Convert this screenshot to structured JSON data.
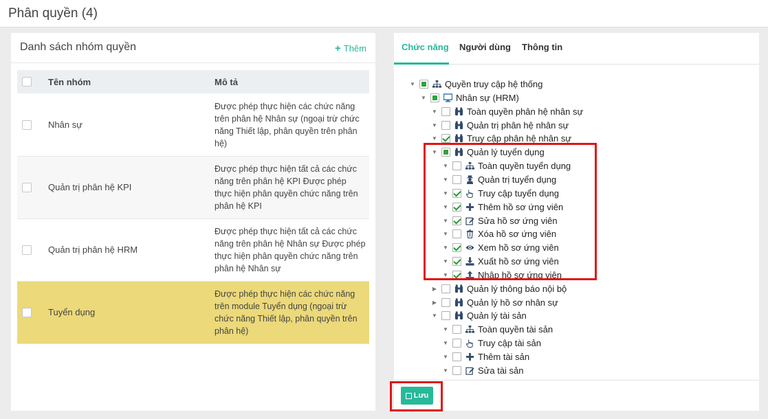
{
  "header": {
    "title": "Phân quyền (4)"
  },
  "left": {
    "title": "Danh sách nhóm quyền",
    "add_label": "Thêm",
    "columns": {
      "name": "Tên nhóm",
      "desc": "Mô tả"
    },
    "rows": [
      {
        "name": "Nhân sự",
        "desc": "Được phép thực hiện các chức năng trên phân hệ Nhân sự (ngoại trừ chức năng Thiết lập, phân quyền trên phân hệ)"
      },
      {
        "name": "Quản trị phân hệ KPI",
        "desc": "Được phép thực hiện tất cả các chức năng trên phân hệ KPI Được phép thực hiện phân quyền chức năng trên phân hệ KPI"
      },
      {
        "name": "Quản trị phân hệ HRM",
        "desc": "Được phép thực hiện tất cả các chức năng trên phân hệ Nhân sự Được phép thực hiện phân quyền chức năng trên phân hệ Nhân sự"
      },
      {
        "name": "Tuyển dụng",
        "desc": "Được phép thực hiện các chức năng trên module Tuyển dụng (ngoại trừ chức năng Thiết lập, phân quyền trên phân hệ)"
      }
    ]
  },
  "right": {
    "tabs": [
      "Chức năng",
      "Người dùng",
      "Thông tin"
    ],
    "tree": [
      {
        "label": "Quyền truy cập hệ thống",
        "level": 0,
        "toggle": "down",
        "check": "partial",
        "icon": "sitemap-icon"
      },
      {
        "label": "Nhân sự (HRM)",
        "level": 1,
        "toggle": "down",
        "check": "partial",
        "icon": "desktop-icon"
      },
      {
        "label": "Toàn quyền phân hệ nhân sự",
        "level": 2,
        "toggle": "down",
        "check": "none",
        "icon": "binoculars-icon"
      },
      {
        "label": "Quản trị phân hệ nhân sự",
        "level": 2,
        "toggle": "down",
        "check": "none",
        "icon": "binoculars-icon"
      },
      {
        "label": "Truy cập phân hệ nhân sự",
        "level": 2,
        "toggle": "down",
        "check": "checked",
        "icon": "binoculars-icon"
      },
      {
        "label": "Quản lý tuyển dụng",
        "level": 2,
        "toggle": "down",
        "check": "partial",
        "icon": "binoculars-icon"
      },
      {
        "label": "Toàn quyền tuyển dụng",
        "level": 3,
        "toggle": "down",
        "check": "none",
        "icon": "sitemap-icon"
      },
      {
        "label": "Quản trị tuyển dụng",
        "level": 3,
        "toggle": "down",
        "check": "none",
        "icon": "user-secret-icon"
      },
      {
        "label": "Truy cập tuyển dụng",
        "level": 3,
        "toggle": "down",
        "check": "checked",
        "icon": "hand-pointer-icon"
      },
      {
        "label": "Thêm hồ sơ ứng viên",
        "level": 3,
        "toggle": "down",
        "check": "checked",
        "icon": "plus-icon"
      },
      {
        "label": "Sửa hồ sơ ứng viên",
        "level": 3,
        "toggle": "down",
        "check": "checked",
        "icon": "edit-icon"
      },
      {
        "label": "Xóa hồ sơ ứng viên",
        "level": 3,
        "toggle": "down",
        "check": "none",
        "icon": "trash-icon"
      },
      {
        "label": "Xem hồ sơ ứng viên",
        "level": 3,
        "toggle": "down",
        "check": "checked",
        "icon": "eye-icon"
      },
      {
        "label": "Xuất hồ sơ ứng viên",
        "level": 3,
        "toggle": "down",
        "check": "checked",
        "icon": "download-icon"
      },
      {
        "label": "Nhập hồ sơ ứng viên",
        "level": 3,
        "toggle": "down",
        "check": "checked",
        "icon": "upload-icon"
      },
      {
        "label": "Quản lý thông báo nội bộ",
        "level": 2,
        "toggle": "right",
        "check": "none",
        "icon": "binoculars-icon"
      },
      {
        "label": "Quản lý hồ sơ nhân sự",
        "level": 2,
        "toggle": "right",
        "check": "none",
        "icon": "binoculars-icon"
      },
      {
        "label": "Quản lý tài sản",
        "level": 2,
        "toggle": "down",
        "check": "none",
        "icon": "binoculars-icon"
      },
      {
        "label": "Toàn quyền tài sản",
        "level": 3,
        "toggle": "down",
        "check": "none",
        "icon": "sitemap-icon"
      },
      {
        "label": "Truy cập tài sản",
        "level": 3,
        "toggle": "down",
        "check": "none",
        "icon": "hand-pointer-icon"
      },
      {
        "label": "Thêm tài sản",
        "level": 3,
        "toggle": "down",
        "check": "none",
        "icon": "plus-icon"
      },
      {
        "label": "Sửa tài sản",
        "level": 3,
        "toggle": "down",
        "check": "none",
        "icon": "edit-icon"
      }
    ],
    "save_label": "Lưu"
  },
  "colors": {
    "accent": "#26b99a",
    "highlight": "#e01414",
    "selected_row": "#ecd97a"
  }
}
